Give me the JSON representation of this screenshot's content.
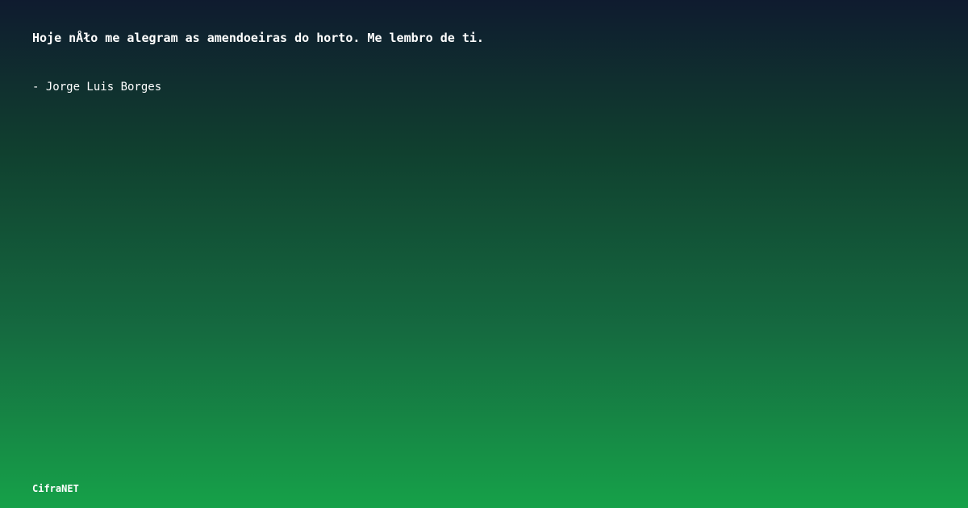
{
  "quote": {
    "text": "Hoje nÅło me alegram as amendoeiras do horto. Me lembro de ti.",
    "author": "- Jorge Luis Borges"
  },
  "brand": {
    "name": "CifraNET"
  },
  "colors": {
    "gradient_top": "#0f1b2f",
    "gradient_bottom": "#16a149",
    "text": "#ffffff"
  }
}
